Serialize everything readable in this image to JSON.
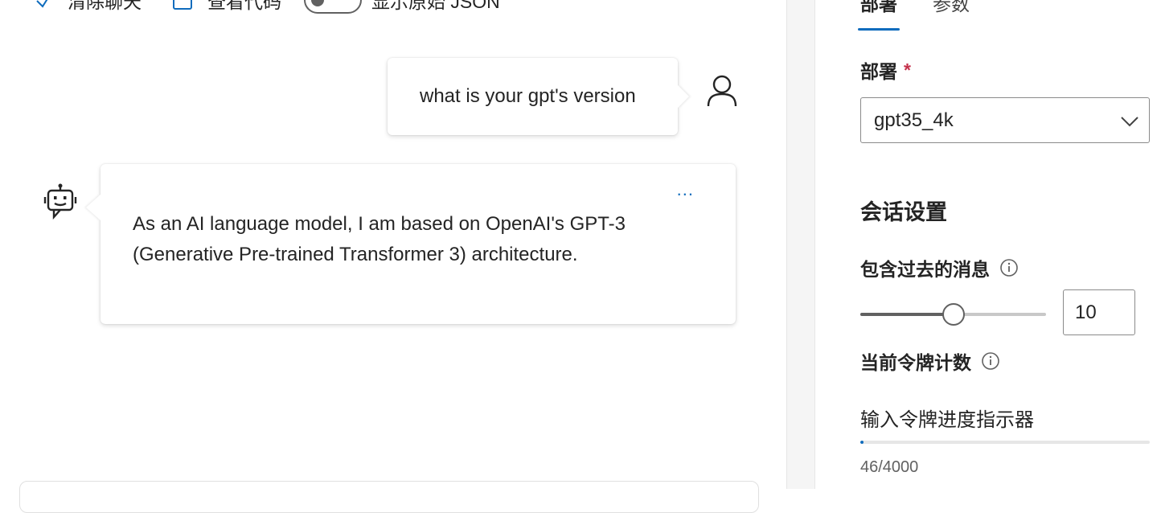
{
  "toolbar": {
    "clear_label": "清除聊天",
    "view_code_label": "查看代码",
    "raw_json_label": "显示原始 JSON",
    "raw_json_enabled": false
  },
  "chat": {
    "messages": [
      {
        "role": "user",
        "text": "what is your gpt's version"
      },
      {
        "role": "assistant",
        "text": "As an AI language model, I am based on OpenAI's GPT-3 (Generative Pre-trained Transformer 3) architecture.",
        "more_label": "..."
      }
    ]
  },
  "settings": {
    "tabs": [
      {
        "label": "部署",
        "active": true
      },
      {
        "label": "参数",
        "active": false
      }
    ],
    "deployment": {
      "label": "部署",
      "required_mark": "*",
      "selected": "gpt35_4k"
    },
    "session": {
      "title": "会话设置",
      "past_messages": {
        "label": "包含过去的消息",
        "value": "10",
        "min": 0,
        "max": 20,
        "level": 10
      },
      "token_count": {
        "label": "当前令牌计数",
        "progress_label": "输入令牌进度指示器",
        "count_text": "46/4000",
        "used": 46,
        "total": 4000
      }
    }
  },
  "colors": {
    "accent": "#0f6cbd",
    "required": "#c4314b",
    "text": "#242424"
  }
}
